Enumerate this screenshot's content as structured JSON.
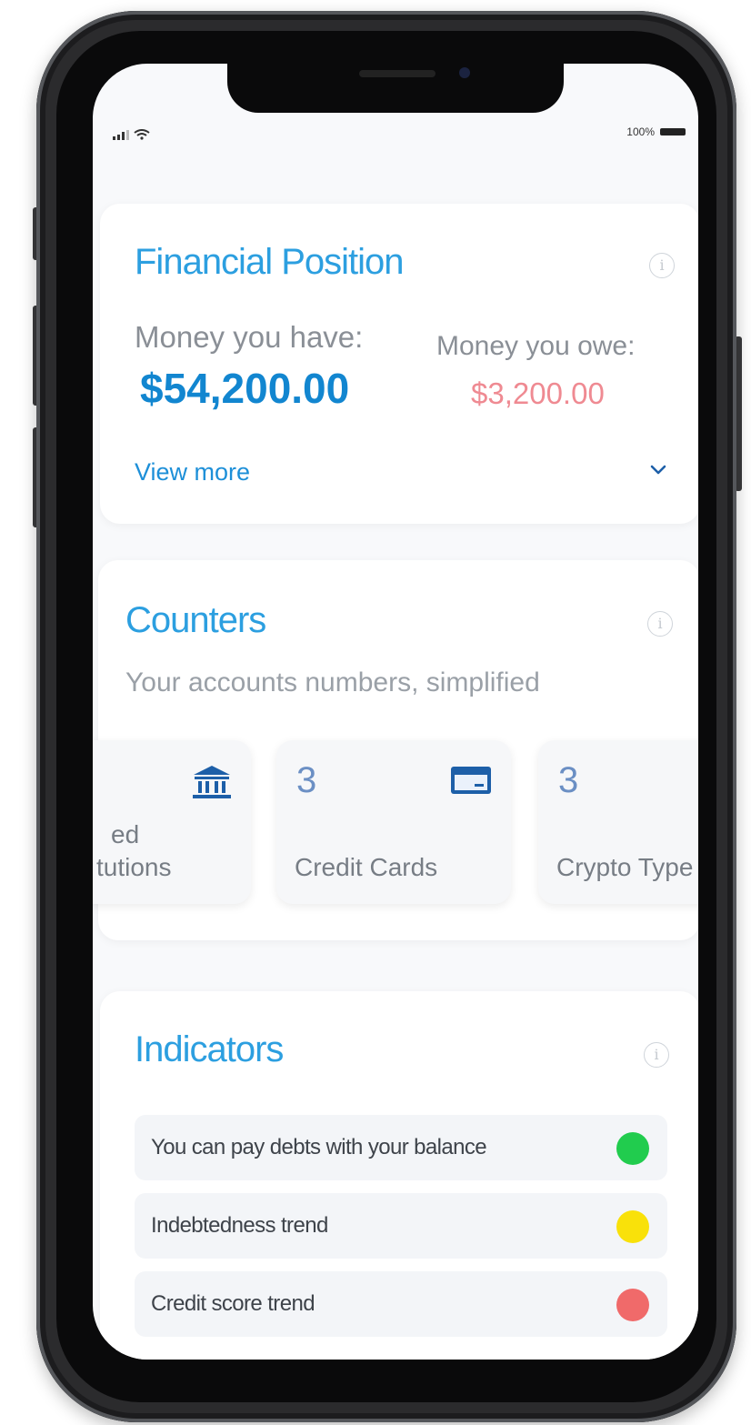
{
  "status_bar": {
    "battery_text": "100%"
  },
  "financial_position": {
    "title": "Financial Position",
    "info": "i",
    "money_have_label": "Money you have:",
    "money_have_value": "$54,200.00",
    "money_owe_label": "Money you owe:",
    "money_owe_value": "$3,200.00",
    "view_more": "View more"
  },
  "counters": {
    "title": "Counters",
    "info": "i",
    "subtitle": "Your accounts numbers, simplified",
    "items": [
      {
        "label_line1": "ed",
        "label_line2": "tutions",
        "icon": "bank-icon"
      },
      {
        "number": "3",
        "label": "Credit Cards",
        "icon": "credit-card-icon"
      },
      {
        "number": "3",
        "label": "Crypto Type"
      }
    ]
  },
  "indicators": {
    "title": "Indicators",
    "info": "i",
    "items": [
      {
        "label": "You can pay debts with your balance",
        "status": "green",
        "color": "#21cc4e"
      },
      {
        "label": "Indebtedness trend",
        "status": "yellow",
        "color": "#f9e10a"
      },
      {
        "label": "Credit score trend",
        "status": "red",
        "color": "#f06a6a"
      }
    ]
  },
  "colors": {
    "accent": "#2c9fe0",
    "primary_value": "#1286d0",
    "debt_value": "#ef8a92"
  }
}
